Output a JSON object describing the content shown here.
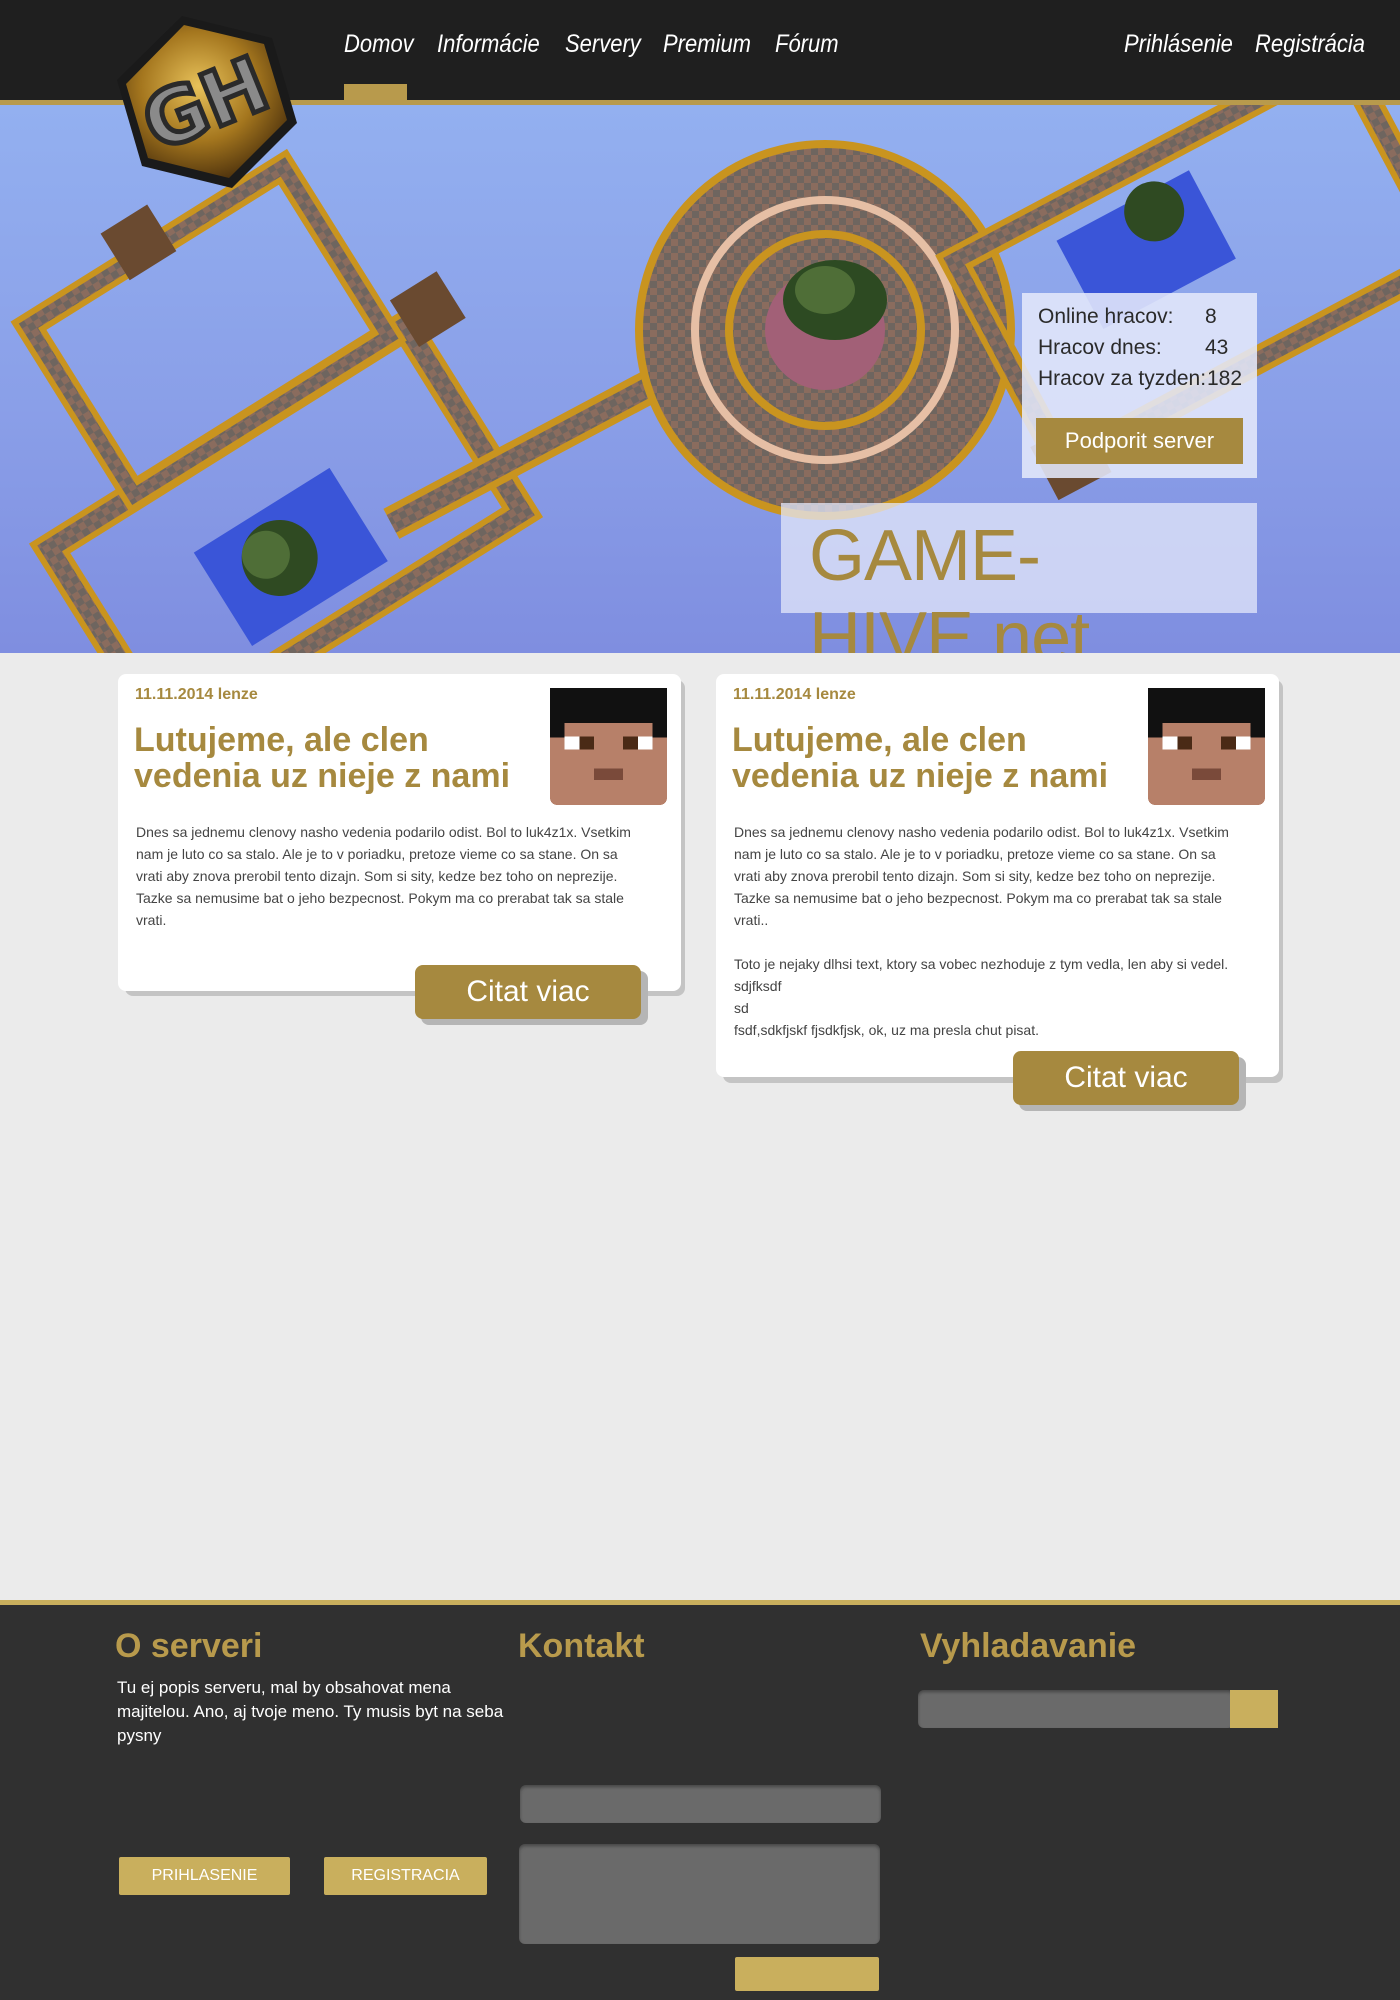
{
  "nav": {
    "items": [
      "Domov",
      "Informácie",
      "Servery",
      "Premium",
      "Fórum"
    ],
    "active": "Domov",
    "auth": {
      "login": "Prihlásenie",
      "register": "Registrácia"
    }
  },
  "hero": {
    "stats": [
      {
        "label": "Online hracov:",
        "value": "8"
      },
      {
        "label": "Hracov dnes:",
        "value": "43"
      },
      {
        "label": "Hracov za tyzden:",
        "value": "182"
      }
    ],
    "support_button": "Podporit server",
    "brand": "GAME-HIVE.net"
  },
  "posts": [
    {
      "meta": "11.11.2014 lenze",
      "title": "Lutujeme, ale clen vedenia uz nieje z nami",
      "paragraphs": [
        "Dnes sa jednemu clenovy nasho vedenia podarilo odist. Bol to luk4z1x. Vsetkim nam je luto co sa stalo. Ale je to v poriadku, pretoze vieme co sa stane. On sa vrati aby znova prerobil tento dizajn. Som si sity, kedze bez toho on neprezije. Tazke sa nemusime bat o jeho bezpecnost. Pokym ma co prerabat tak sa stale vrati."
      ],
      "read_more": "Citat viac"
    },
    {
      "meta": "11.11.2014 lenze",
      "title": "Lutujeme, ale clen vedenia uz nieje z nami",
      "paragraphs": [
        "Dnes sa jednemu clenovy nasho vedenia podarilo odist. Bol to luk4z1x. Vsetkim nam je luto co sa stalo. Ale je to v poriadku, pretoze vieme co sa stane. On sa vrati aby znova prerobil tento dizajn. Som si sity, kedze bez toho on neprezije. Tazke sa nemusime bat o jeho bezpecnost. Pokym ma co prerabat tak sa stale vrati..",
        "Toto je nejaky dlhsi text, ktory sa vobec nezhoduje z tym vedla, len aby si vedel.",
        "sdjfksdf",
        "sd",
        "fsdf,sdkfjskf fjsdkfjsk, ok, uz ma presla chut pisat."
      ],
      "read_more": "Citat viac"
    }
  ],
  "footer": {
    "about": {
      "heading": "O serveri",
      "text": "Tu ej popis serveru, mal by obsahovat mena majitelou. Ano, aj tvoje meno. Ty musis byt na seba pysny"
    },
    "login_button": "PRIHLASENIE",
    "register_button": "REGISTRACIA",
    "contact_heading": "Kontakt",
    "search_heading": "Vyhladavanie"
  },
  "colors": {
    "gold": "#a6893f",
    "gold_light": "#c9af5d",
    "header_bg": "#1f1f1f",
    "footer_bg": "#303030",
    "page_bg": "#ebebeb"
  },
  "icons": {
    "logo": "game-hive-logo",
    "avatar": "minecraft-steve-avatar"
  }
}
